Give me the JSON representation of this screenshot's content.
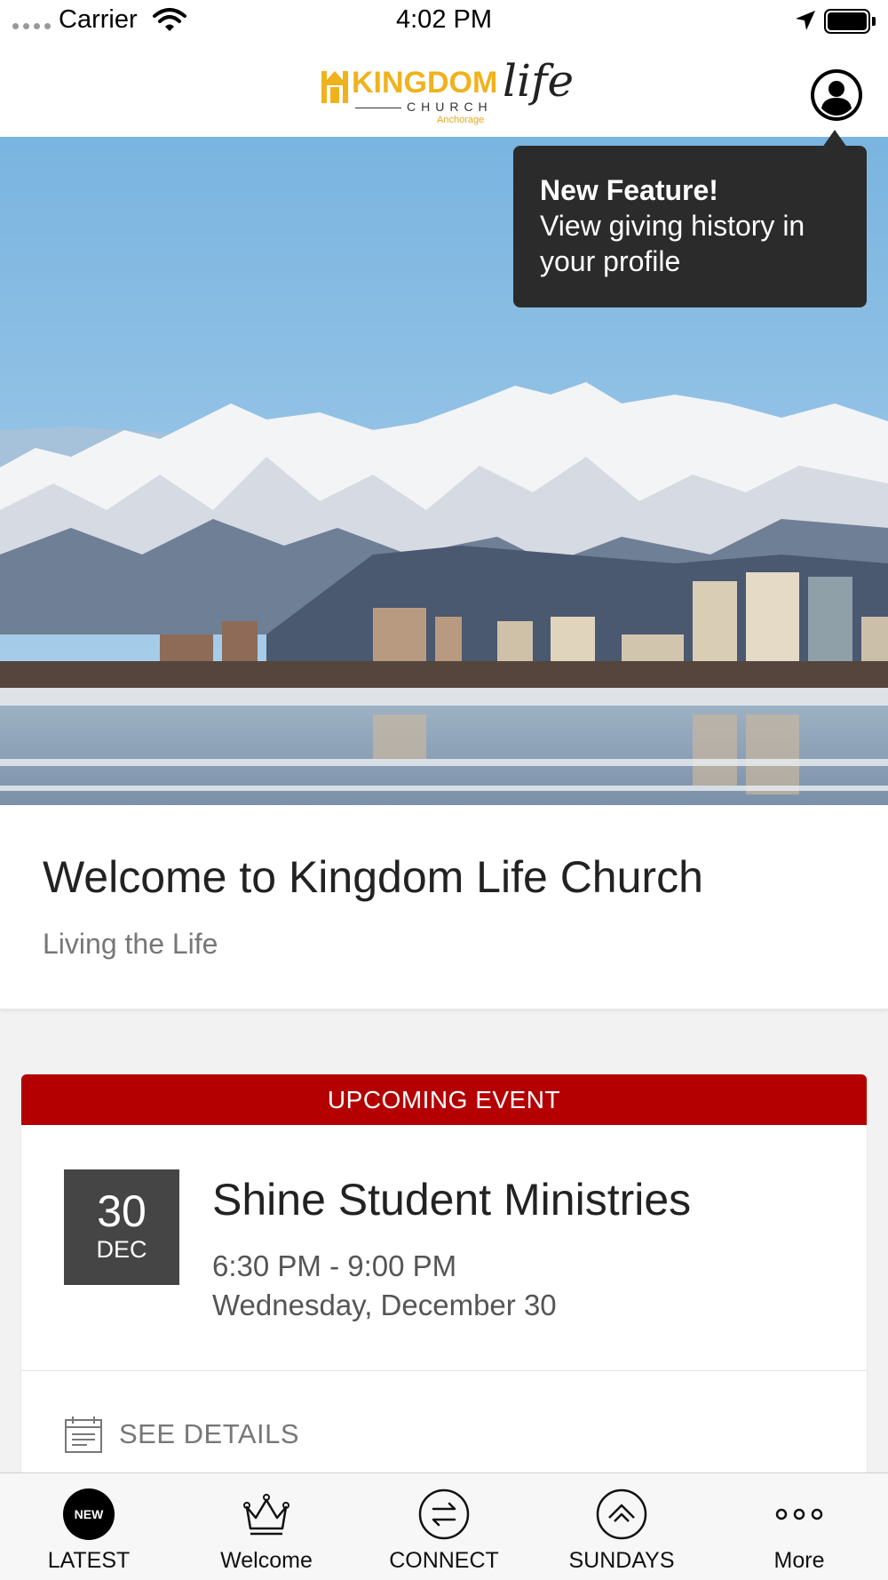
{
  "status_bar": {
    "carrier": "Carrier",
    "time": "4:02 PM"
  },
  "header": {
    "logo": {
      "kingdom": "KINGDOM",
      "life": "life",
      "church": "CHURCH",
      "location": "Anchorage"
    },
    "profile_icon": "user-circle-icon"
  },
  "tooltip": {
    "title": "New Feature!",
    "body": "View giving history in your profile"
  },
  "welcome": {
    "title": "Welcome to Kingdom Life Church",
    "subtitle": "Living the Life"
  },
  "event": {
    "banner": "UPCOMING EVENT",
    "day": "30",
    "month": "DEC",
    "title": "Shine Student Ministries",
    "time": "6:30 PM - 9:00 PM",
    "date": "Wednesday, December 30",
    "details_label": "SEE DETAILS"
  },
  "tabs": [
    {
      "label": "LATEST",
      "badge": "NEW",
      "icon": "new-badge-icon",
      "selected": true
    },
    {
      "label": "Welcome",
      "icon": "crown-icon"
    },
    {
      "label": "CONNECT",
      "icon": "exchange-arrows-icon"
    },
    {
      "label": "SUNDAYS",
      "icon": "double-chevron-up-icon"
    },
    {
      "label": "More",
      "icon": "more-dots-icon"
    }
  ],
  "colors": {
    "accent_red": "#b40000",
    "date_box": "#454545",
    "tooltip_bg": "#2b2b2b",
    "logo_gold": "#f0b21c"
  }
}
